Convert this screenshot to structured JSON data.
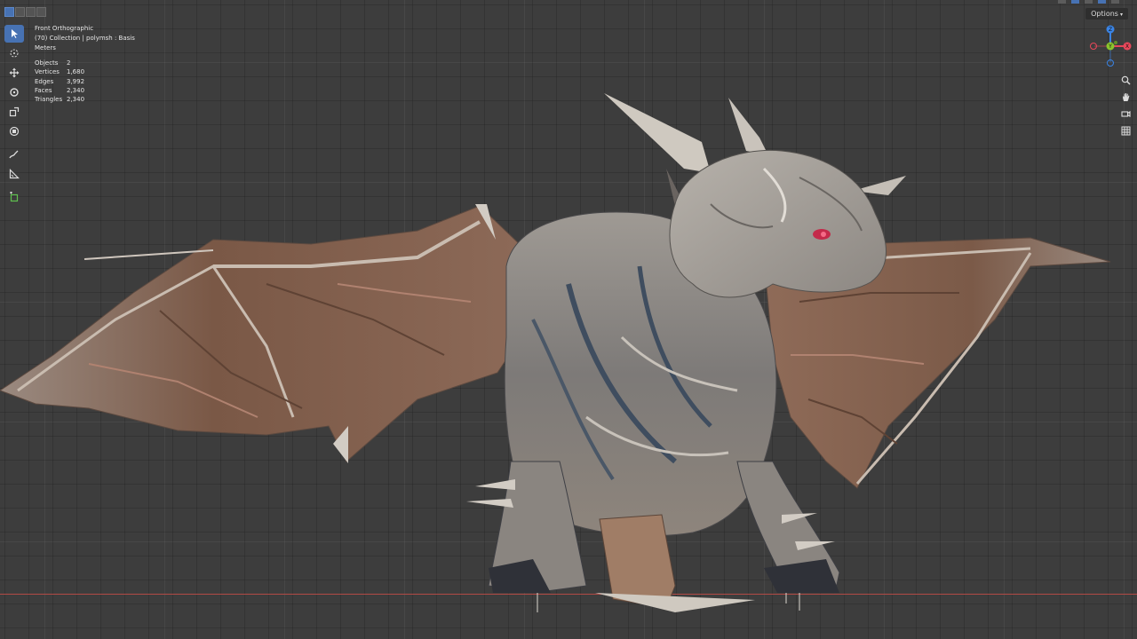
{
  "viewport": {
    "view_name": "Front Orthographic",
    "collection_info": "(70) Collection | polymsh : Basis",
    "units": "Meters"
  },
  "stats": [
    {
      "label": "Objects",
      "value": "2"
    },
    {
      "label": "Vertices",
      "value": "1,680"
    },
    {
      "label": "Edges",
      "value": "3,992"
    },
    {
      "label": "Faces",
      "value": "2,340"
    },
    {
      "label": "Triangles",
      "value": "2,340"
    }
  ],
  "header": {
    "options_label": "Options"
  },
  "gizmo": {
    "z_label": "Z",
    "y_label": "Y",
    "x_label": "X"
  },
  "toolbar": {
    "tools": [
      "select-box-icon",
      "cursor-icon",
      "move-icon",
      "rotate-icon",
      "scale-icon",
      "transform-icon",
      "annotate-icon",
      "measure-icon",
      "add-cube-icon"
    ]
  },
  "colors": {
    "viewport_bg": "#3d3d3d",
    "accent": "#4772b3",
    "x_axis": "#b24a45",
    "gizmo_x": "#e8475a",
    "gizmo_y": "#8ac42c",
    "gizmo_z": "#3a84e6"
  }
}
